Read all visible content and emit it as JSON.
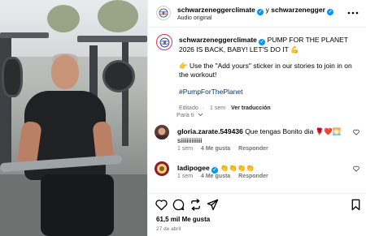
{
  "header": {
    "username": "schwarzeneggerclimate",
    "separator": "y",
    "collab_username": "schwarzenegger",
    "audio_label": "Audio original",
    "more_icon": "more-horizontal-icon"
  },
  "caption": {
    "username": "schwarzeneggerclimate",
    "line1": "PUMP FOR THE PLANET 2026 IS BACK, BABY! LET'S DO IT 💪",
    "line2": "👉 Use the \"Add yours\" sticker in our stories to join in on the workout!",
    "hashtag": "#PumpForThePlanet",
    "edited": "Editado",
    "dot": "·",
    "time": "1 sem",
    "translate": "Ver traducción"
  },
  "for_you": "Para ti",
  "comments": [
    {
      "username": "gloria.zarate.549436",
      "text": "Que tengas Bonito dia 🌹❤️🌅 siiiiiiiiiiiiii",
      "time": "1 sem",
      "likes": "4 Me gusta",
      "reply": "Responder"
    },
    {
      "username": "ladipogee",
      "text": "👏👏👏👏",
      "time": "1 sem",
      "likes": "4 Me gusta",
      "reply": "Responder"
    }
  ],
  "actions": {
    "like_icon": "heart-icon",
    "comment_icon": "comment-icon",
    "share_icon": "repost-icon",
    "send_icon": "send-icon",
    "save_icon": "bookmark-icon"
  },
  "likes_count": "61,5 mil Me gusta",
  "date": "27 de abril",
  "colors": {
    "verified": "#0095f6",
    "hashtag": "#00376b",
    "meta": "#737373",
    "border": "#efefef"
  }
}
